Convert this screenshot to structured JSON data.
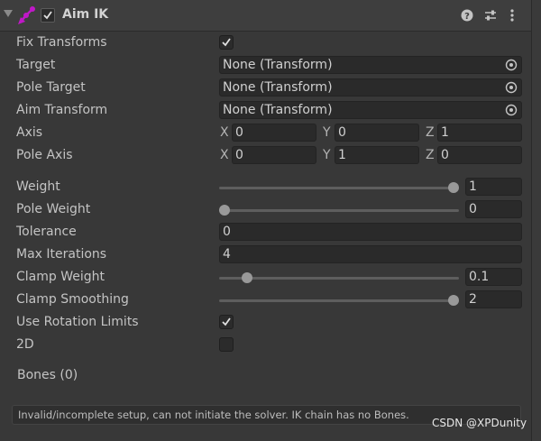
{
  "header": {
    "title": "Aim IK",
    "enabled": true,
    "component_icon": "ik-component-icon",
    "accent_color": "#c018c8"
  },
  "properties": {
    "fix_transforms": {
      "label": "Fix Transforms",
      "checked": true
    },
    "target": {
      "label": "Target",
      "value": "None (Transform)"
    },
    "pole_target": {
      "label": "Pole Target",
      "value": "None (Transform)"
    },
    "aim_transform": {
      "label": "Aim Transform",
      "value": "None (Transform)"
    },
    "axis": {
      "label": "Axis",
      "x_label": "X",
      "y_label": "Y",
      "z_label": "Z",
      "x": "0",
      "y": "0",
      "z": "1"
    },
    "pole_axis": {
      "label": "Pole Axis",
      "x_label": "X",
      "y_label": "Y",
      "z_label": "Z",
      "x": "0",
      "y": "1",
      "z": "0"
    },
    "weight": {
      "label": "Weight",
      "value": "1",
      "fraction": 1.0
    },
    "pole_weight": {
      "label": "Pole Weight",
      "value": "0",
      "fraction": 0.0
    },
    "tolerance": {
      "label": "Tolerance",
      "value": "0"
    },
    "max_iterations": {
      "label": "Max Iterations",
      "value": "4"
    },
    "clamp_weight": {
      "label": "Clamp Weight",
      "value": "0.1",
      "fraction": 0.1
    },
    "clamp_smoothing": {
      "label": "Clamp Smoothing",
      "value": "2",
      "fraction": 1.0
    },
    "use_rotation_limits": {
      "label": "Use Rotation Limits",
      "checked": true
    },
    "two_d": {
      "label": "2D",
      "checked": false
    }
  },
  "bones": {
    "label": "Bones (0)"
  },
  "help_box": {
    "text": "Invalid/incomplete setup, can not initiate the solver. IK chain has no Bones."
  },
  "watermark": {
    "text": "CSDN @XPDunity"
  },
  "colors": {
    "background": "#383838",
    "field": "#2a2a2a",
    "text": "#c4c4c4",
    "slider_knob": "#999999"
  }
}
